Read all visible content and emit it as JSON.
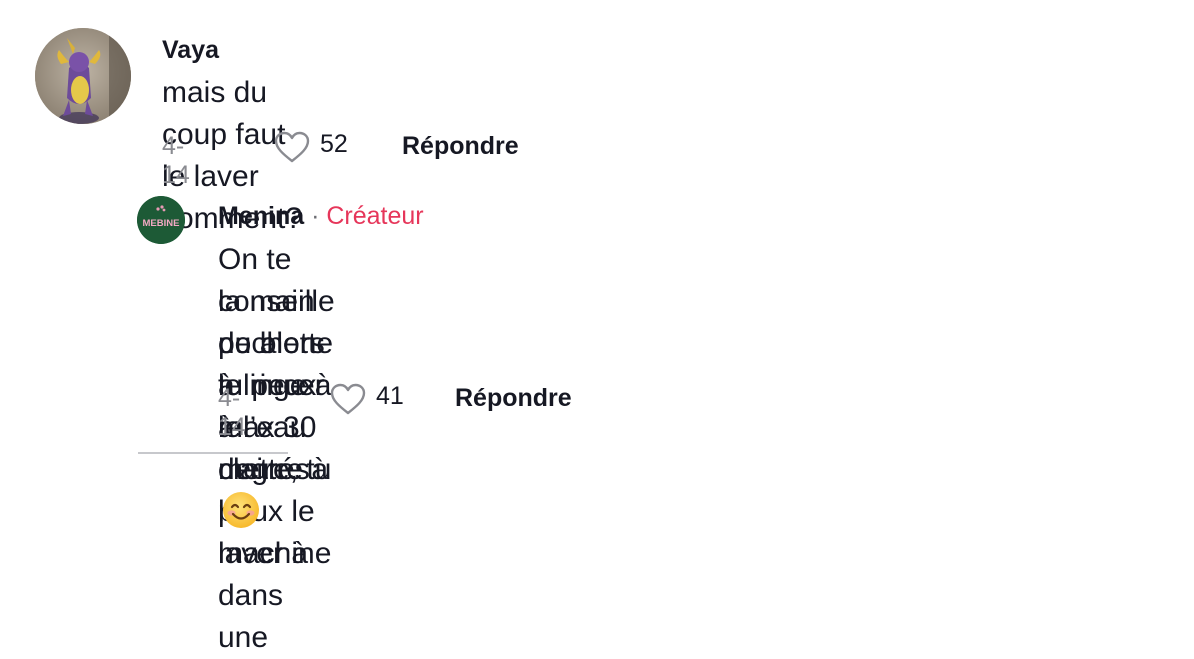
{
  "comments": [
    {
      "username": "Vaya",
      "text": "mais du coup faut le laver comment?",
      "date": "4-14",
      "likes": "52",
      "reply_label": "Répondre"
    }
  ],
  "reply": {
    "username": "Menina",
    "separator": "·",
    "badge": "Créateur",
    "text_line1": "On te conseille de bien le rincer à l’eau claire, tu peux le laver à",
    "text_line2": "la main ou alors tu peux le mettre à la machine dans une",
    "text_line3": "pochette à linge à max 30 degrés",
    "date": "4-14",
    "likes": "41",
    "reply_label": "Répondre",
    "avatar_logo_text": "MEBINE"
  },
  "colors": {
    "creator_badge": "#e6365a",
    "muted": "#8a8b91",
    "avatar_green": "#1d5a36"
  }
}
